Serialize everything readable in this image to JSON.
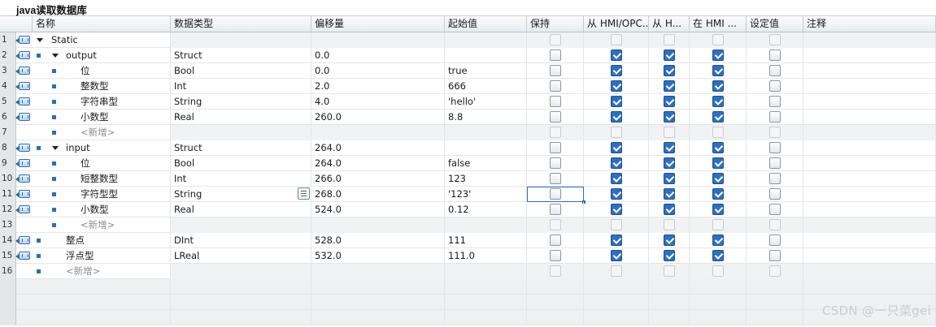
{
  "title": "java读取数据库",
  "columns": [
    {
      "key": "name",
      "label": "名称"
    },
    {
      "key": "type",
      "label": "数据类型"
    },
    {
      "key": "offset",
      "label": "偏移量"
    },
    {
      "key": "start",
      "label": "起始值"
    },
    {
      "key": "retain",
      "label": "保持"
    },
    {
      "key": "hmi_opc",
      "label": "从 HMI/OPC..."
    },
    {
      "key": "hmi_h",
      "label": "从 H..."
    },
    {
      "key": "in_hmi",
      "label": "在 HMI ..."
    },
    {
      "key": "setpoint",
      "label": "设定值"
    },
    {
      "key": "comment",
      "label": "注释"
    }
  ],
  "rows": [
    {
      "num": "1",
      "name": "Static",
      "type": "",
      "offset": "",
      "start": "",
      "level": 0,
      "expand": true,
      "icon": true,
      "bullet": false,
      "cbs": [
        false,
        false,
        false,
        false,
        false
      ],
      "dis": true
    },
    {
      "num": "2",
      "name": "output",
      "type": "Struct",
      "offset": "0.0",
      "start": "",
      "level": 1,
      "expand": true,
      "icon": true,
      "bullet": true,
      "cbs": [
        false,
        true,
        true,
        true,
        false
      ]
    },
    {
      "num": "3",
      "name": "位",
      "type": "Bool",
      "offset": "0.0",
      "start": "true",
      "level": 2,
      "icon": true,
      "bullet": true,
      "cbs": [
        false,
        true,
        true,
        true,
        false
      ]
    },
    {
      "num": "4",
      "name": "整数型",
      "type": "Int",
      "offset": "2.0",
      "start": "666",
      "level": 2,
      "icon": true,
      "bullet": true,
      "cbs": [
        false,
        true,
        true,
        true,
        false
      ]
    },
    {
      "num": "5",
      "name": "字符串型",
      "type": "String",
      "offset": "4.0",
      "start": "'hello'",
      "level": 2,
      "icon": true,
      "bullet": true,
      "cbs": [
        false,
        true,
        true,
        true,
        false
      ]
    },
    {
      "num": "6",
      "name": "小数型",
      "type": "Real",
      "offset": "260.0",
      "start": "8.8",
      "level": 2,
      "icon": true,
      "bullet": true,
      "cbs": [
        false,
        true,
        true,
        true,
        false
      ]
    },
    {
      "num": "7",
      "name": "<新增>",
      "type": "",
      "offset": "",
      "start": "",
      "level": 2,
      "icon": false,
      "bullet": true,
      "placeholder": true,
      "cbs": [
        false,
        false,
        false,
        false,
        false
      ],
      "dis": true
    },
    {
      "num": "8",
      "name": "input",
      "type": "Struct",
      "offset": "264.0",
      "start": "",
      "level": 1,
      "expand": true,
      "icon": true,
      "bullet": true,
      "cbs": [
        false,
        true,
        true,
        true,
        false
      ]
    },
    {
      "num": "9",
      "name": "位",
      "type": "Bool",
      "offset": "264.0",
      "start": "false",
      "level": 2,
      "icon": true,
      "bullet": true,
      "cbs": [
        false,
        true,
        true,
        true,
        false
      ]
    },
    {
      "num": "10",
      "name": "短整数型",
      "type": "Int",
      "offset": "266.0",
      "start": "123",
      "level": 2,
      "icon": true,
      "bullet": true,
      "cbs": [
        false,
        true,
        true,
        true,
        false
      ]
    },
    {
      "num": "11",
      "name": "字符型型",
      "type": "String",
      "offset": "268.0",
      "start": "'123'",
      "level": 2,
      "icon": true,
      "bullet": true,
      "listbtn": true,
      "selected": true,
      "cbs": [
        false,
        true,
        true,
        true,
        false
      ]
    },
    {
      "num": "12",
      "name": "小数型",
      "type": "Real",
      "offset": "524.0",
      "start": "0.12",
      "level": 2,
      "icon": true,
      "bullet": true,
      "cbs": [
        false,
        true,
        true,
        true,
        false
      ]
    },
    {
      "num": "13",
      "name": "<新增>",
      "type": "",
      "offset": "",
      "start": "",
      "level": 2,
      "icon": false,
      "bullet": true,
      "placeholder": true,
      "cbs": [
        false,
        false,
        false,
        false,
        false
      ],
      "dis": true
    },
    {
      "num": "14",
      "name": "整点",
      "type": "DInt",
      "offset": "528.0",
      "start": "111",
      "level": 1,
      "icon": true,
      "bullet": true,
      "cbs": [
        false,
        true,
        true,
        true,
        false
      ]
    },
    {
      "num": "15",
      "name": "浮点型",
      "type": "LReal",
      "offset": "532.0",
      "start": "111.0",
      "level": 1,
      "icon": true,
      "bullet": true,
      "cbs": [
        false,
        true,
        true,
        true,
        false
      ]
    },
    {
      "num": "16",
      "name": "<新增>",
      "type": "",
      "offset": "",
      "start": "",
      "level": 1,
      "icon": false,
      "bullet": true,
      "placeholder": true,
      "cbs": [
        false,
        false,
        false,
        false,
        false
      ],
      "dis": true
    }
  ],
  "watermark": "CSDN @一只菜gei"
}
